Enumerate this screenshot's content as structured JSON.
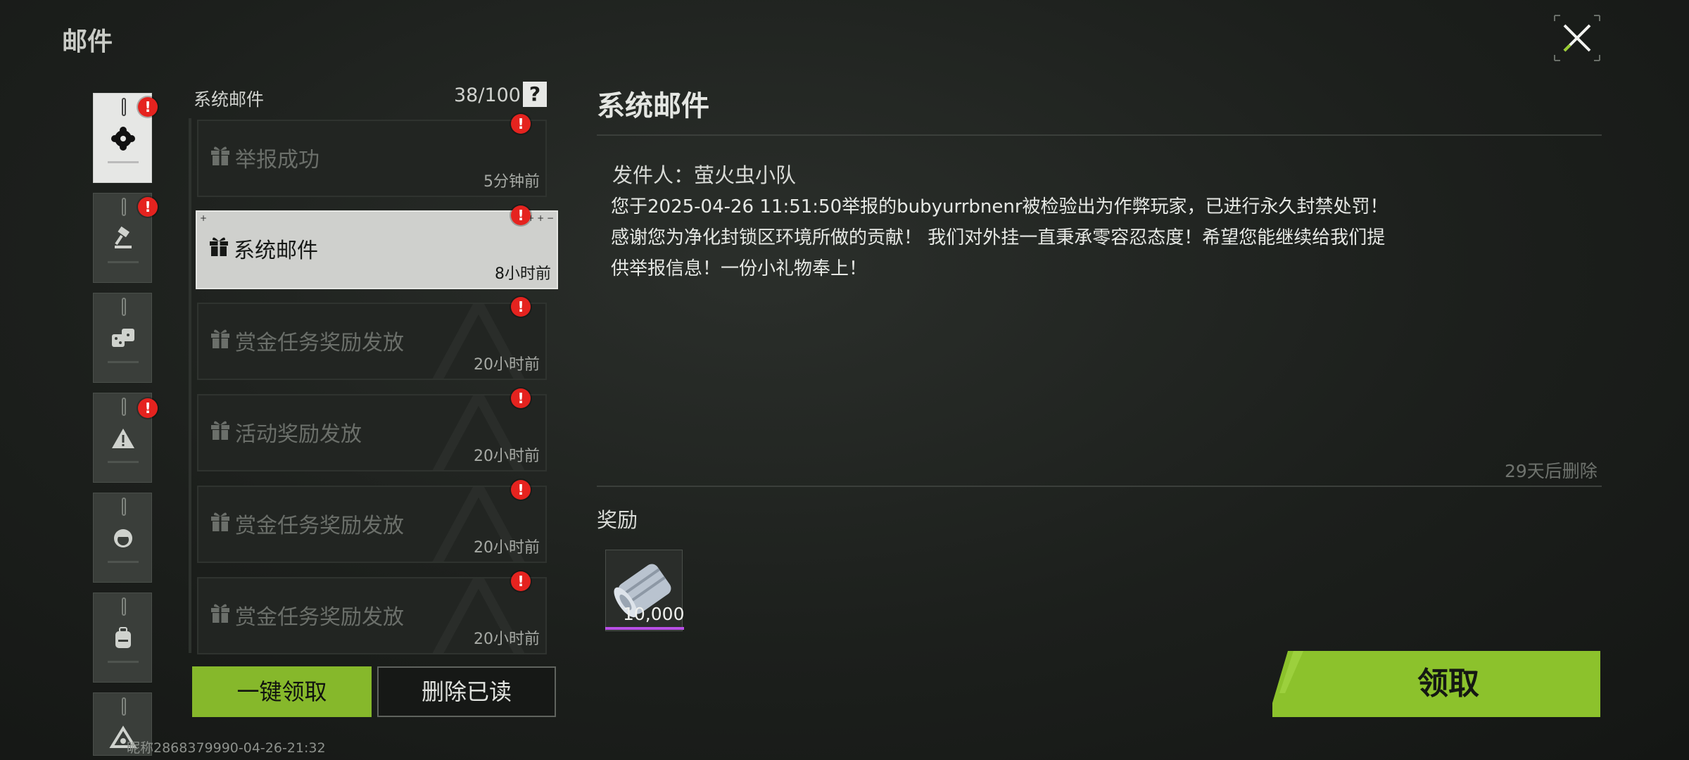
{
  "header": {
    "title": "邮件"
  },
  "categories": [
    {
      "name": "system",
      "active": true,
      "badge": "!"
    },
    {
      "name": "report",
      "active": false,
      "badge": "!"
    },
    {
      "name": "bounty",
      "active": false,
      "badge": ""
    },
    {
      "name": "warning",
      "active": false,
      "badge": "!"
    },
    {
      "name": "character",
      "active": false,
      "badge": ""
    },
    {
      "name": "backpack",
      "active": false,
      "badge": ""
    },
    {
      "name": "faction",
      "active": false,
      "badge": ""
    }
  ],
  "mail_list": {
    "title": "系统邮件",
    "count": "38/100",
    "help": "?",
    "items": [
      {
        "title": "举报成功",
        "time": "5分钟前",
        "badge": "!"
      },
      {
        "title": "系统邮件",
        "time": "8小时前",
        "badge": "!",
        "selected": true
      },
      {
        "title": "赏金任务奖励发放",
        "time": "20小时前",
        "badge": "!"
      },
      {
        "title": "活动奖励发放",
        "time": "20小时前",
        "badge": "!"
      },
      {
        "title": "赏金任务奖励发放",
        "time": "20小时前",
        "badge": "!"
      },
      {
        "title": "赏金任务奖励发放",
        "time": "20小时前",
        "badge": "!"
      }
    ],
    "claim_all": "一键领取",
    "delete_read": "删除已读"
  },
  "footer": {
    "player_id": "昵称2868379990-04-26-21:32"
  },
  "detail": {
    "title": "系统邮件",
    "sender": "发件人：萤火虫小队",
    "body": "您于2025-04-26 11:51:50举报的bubyurrbnenr被检验出为作弊玩家，已进行永久封禁处罚！感谢您为净化封锁区环境所做的贡献！ 我们对外挂一直秉承零容忍态度！希望您能继续给我们提供举报信息！一份小礼物奉上！",
    "expire": "29天后删除",
    "reward_label": "奖励",
    "reward": {
      "icon": "cash-roll-icon",
      "quantity": "10,000"
    },
    "claim": "领取"
  },
  "colors": {
    "accent": "#86b82b",
    "badge": "#e5231f",
    "rarity": "#b84fe6"
  }
}
